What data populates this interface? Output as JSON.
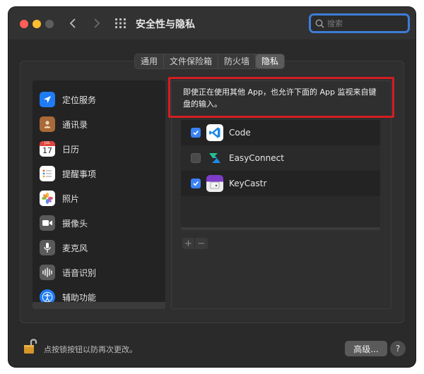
{
  "window": {
    "title": "安全性与隐私"
  },
  "search": {
    "placeholder": "搜索",
    "value": ""
  },
  "tabs": [
    {
      "label": "通用",
      "active": false
    },
    {
      "label": "文件保险箱",
      "active": false
    },
    {
      "label": "防火墙",
      "active": false
    },
    {
      "label": "隐私",
      "active": true
    }
  ],
  "sidebar": {
    "items": [
      {
        "label": "定位服务",
        "icon": "location-arrow-icon"
      },
      {
        "label": "通讯录",
        "icon": "contacts-icon"
      },
      {
        "label": "日历",
        "icon": "calendar-icon",
        "badge_month": "JUL",
        "badge_day": "17"
      },
      {
        "label": "提醒事项",
        "icon": "reminders-icon"
      },
      {
        "label": "照片",
        "icon": "photos-icon"
      },
      {
        "label": "摄像头",
        "icon": "camera-icon"
      },
      {
        "label": "麦克风",
        "icon": "microphone-icon"
      },
      {
        "label": "语音识别",
        "icon": "speech-recognition-icon"
      },
      {
        "label": "辅助功能",
        "icon": "accessibility-icon"
      }
    ]
  },
  "notice": {
    "line1": "即使正在使用其他 App，也允许下面的 App 监视来自键",
    "line2": "盘的输入。"
  },
  "apps": [
    {
      "name": "Code",
      "checked": true,
      "icon": "vscode-icon"
    },
    {
      "name": "EasyConnect",
      "checked": false,
      "icon": "easyconnect-icon"
    },
    {
      "name": "KeyCastr",
      "checked": true,
      "icon": "keycastr-icon"
    }
  ],
  "controls": {
    "add": "+",
    "remove": "−"
  },
  "footer": {
    "lock_text": "点按锁按钮以防再次更改。",
    "advanced_label": "高级...",
    "help_label": "?"
  },
  "colors": {
    "accent": "#3b82f6",
    "highlight_border": "#d21e23",
    "search_focus": "#3d7dd6"
  }
}
